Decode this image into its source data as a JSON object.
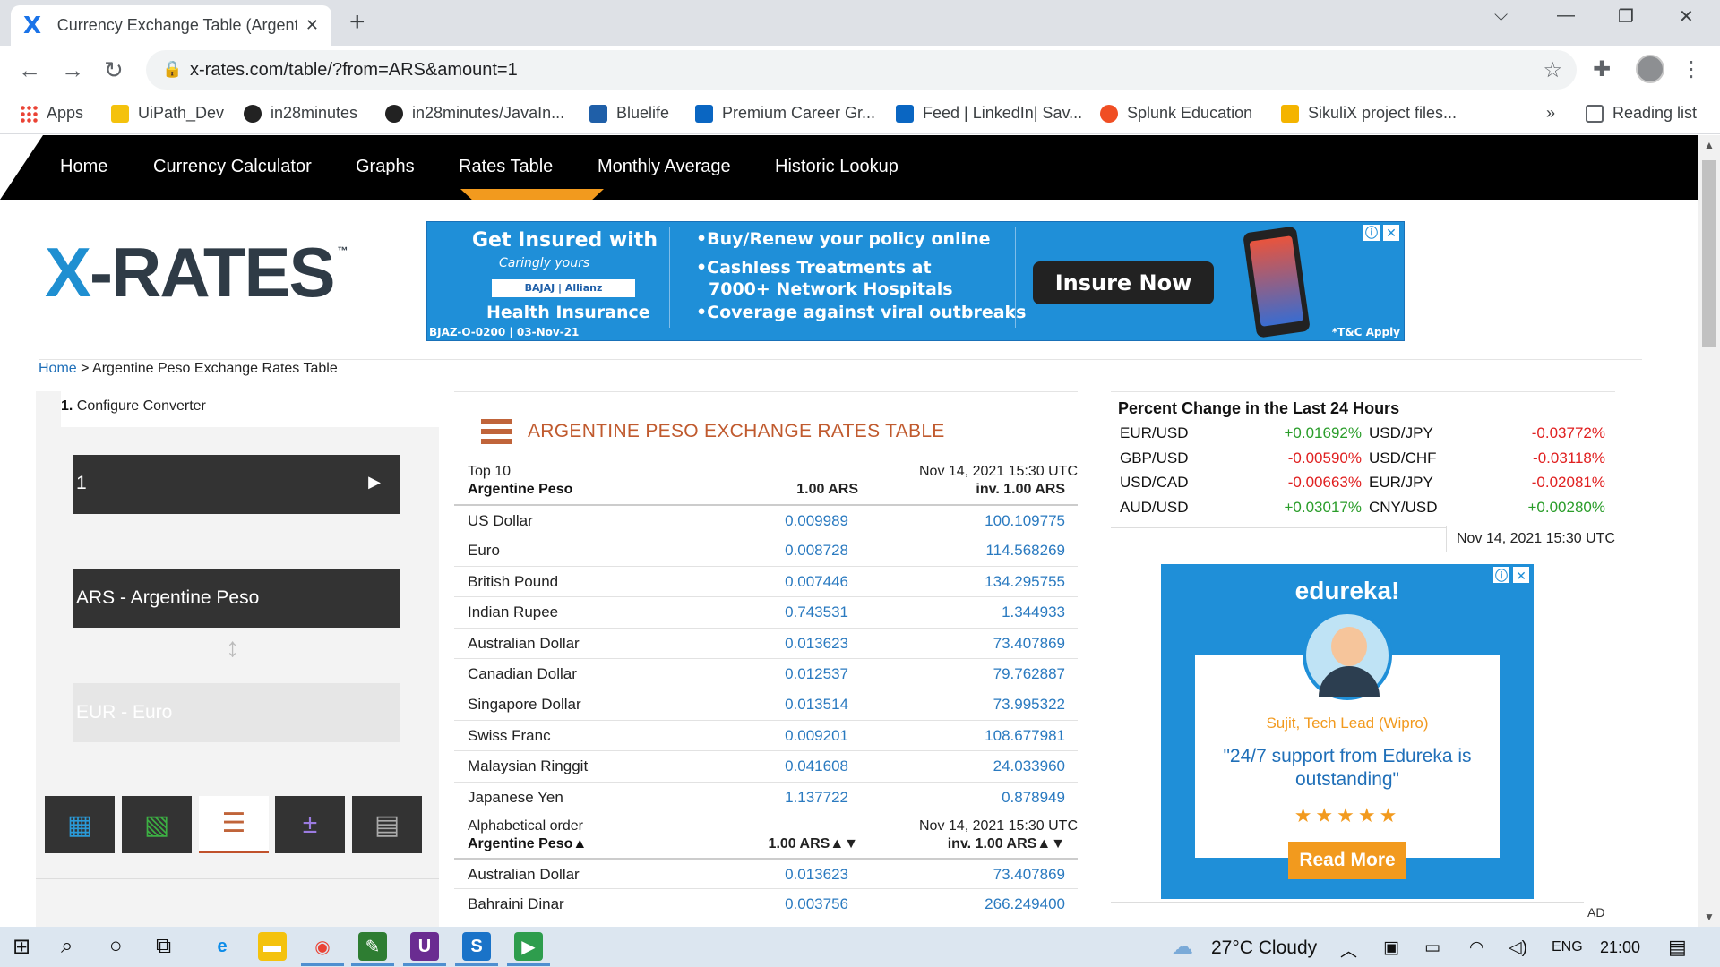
{
  "browser": {
    "tab_title": "Currency Exchange Table (Argentine Peso - ARS) - X-Rates",
    "tab_close": "✕",
    "new_tab": "+",
    "url": "x-rates.com/table/?from=ARS&amount=1",
    "bookmarks": [
      {
        "label": "Apps",
        "color": "#ea4335"
      },
      {
        "label": "UiPath_Dev",
        "color": "#f4c20d"
      },
      {
        "label": "in28minutes",
        "color": "#222222"
      },
      {
        "label": "in28minutes/JavaIn...",
        "color": "#222222"
      },
      {
        "label": "Bluelife",
        "color": "#1f5fa8"
      },
      {
        "label": "Premium Career Gr...",
        "color": "#0a66c2"
      },
      {
        "label": "Feed | LinkedIn| Sav...",
        "color": "#0a66c2"
      },
      {
        "label": "Splunk Education",
        "color": "#f04e23"
      },
      {
        "label": "SikuliX project files...",
        "color": "#f4b400"
      }
    ],
    "overflow": "»",
    "reading_list": "Reading list"
  },
  "site": {
    "nav": [
      "Home",
      "Currency Calculator",
      "Graphs",
      "Rates Table",
      "Monthly Average",
      "Historic Lookup"
    ],
    "active_nav": "Rates Table",
    "accent_color": "#f29a1e",
    "logo_x": "X",
    "logo_rest": "-RATES",
    "logo_tm": "™"
  },
  "ad_top": {
    "headline": "Get Insured with",
    "tagline": "Caringly yours",
    "brand": "BAJAJ | Allianz",
    "product": "Health Insurance",
    "code": "BJAZ-O-0200 | 03-Nov-21",
    "bullets": [
      "•Buy/Renew your policy online",
      "•Cashless Treatments at",
      "7000+ Network Hospitals",
      "•Coverage against viral outbreaks"
    ],
    "cta": "Insure Now",
    "tc": "*T&C Apply"
  },
  "breadcrumb": {
    "home": "Home",
    "sep": " > ",
    "current": "Argentine Peso Exchange Rates Table"
  },
  "converter": {
    "step_num": "1.",
    "step_label": "Configure Converter",
    "amount": "1",
    "from": "ARS - Argentine Peso",
    "to": "EUR - Euro"
  },
  "table": {
    "title": "ARGENTINE PESO EXCHANGE RATES TABLE",
    "top_label": "Top 10",
    "date": "Nov 14, 2021 15:30 UTC",
    "base": "Argentine Peso",
    "col1": "1.00 ARS",
    "col2": "inv. 1.00 ARS",
    "top10": [
      {
        "name": "US Dollar",
        "rate": "0.009989",
        "inv": "100.109775"
      },
      {
        "name": "Euro",
        "rate": "0.008728",
        "inv": "114.568269"
      },
      {
        "name": "British Pound",
        "rate": "0.007446",
        "inv": "134.295755"
      },
      {
        "name": "Indian Rupee",
        "rate": "0.743531",
        "inv": "1.344933"
      },
      {
        "name": "Australian Dollar",
        "rate": "0.013623",
        "inv": "73.407869"
      },
      {
        "name": "Canadian Dollar",
        "rate": "0.012537",
        "inv": "79.762887"
      },
      {
        "name": "Singapore Dollar",
        "rate": "0.013514",
        "inv": "73.995322"
      },
      {
        "name": "Swiss Franc",
        "rate": "0.009201",
        "inv": "108.677981"
      },
      {
        "name": "Malaysian Ringgit",
        "rate": "0.041608",
        "inv": "24.033960"
      },
      {
        "name": "Japanese Yen",
        "rate": "1.137722",
        "inv": "0.878949"
      }
    ],
    "alpha_label": "Alphabetical order",
    "alpha_base": "Argentine Peso▲",
    "alpha_col1": "1.00 ARS▲▼",
    "alpha_col2": "inv. 1.00 ARS▲▼",
    "alpha": [
      {
        "name": "Australian Dollar",
        "rate": "0.013623",
        "inv": "73.407869"
      },
      {
        "name": "Bahraini Dinar",
        "rate": "0.003756",
        "inv": "266.249400"
      }
    ]
  },
  "percent_change": {
    "title": "Percent Change in the Last 24 Hours",
    "rows": [
      {
        "p1": "EUR/USD",
        "v1": "+0.01692%",
        "p2": "USD/JPY",
        "v2": "-0.03772%"
      },
      {
        "p1": "GBP/USD",
        "v1": "-0.00590%",
        "p2": "USD/CHF",
        "v2": "-0.03118%"
      },
      {
        "p1": "USD/CAD",
        "v1": "-0.00663%",
        "p2": "EUR/JPY",
        "v2": "-0.02081%"
      },
      {
        "p1": "AUD/USD",
        "v1": "+0.03017%",
        "p2": "CNY/USD",
        "v2": "+0.00280%"
      }
    ],
    "date": "Nov 14, 2021 15:30 UTC",
    "pos_color": "#2a9d2a",
    "neg_color": "#e02020"
  },
  "ad_side": {
    "brand": "edureka!",
    "who": "Sujit, Tech Lead (Wipro)",
    "quote": "\"24/7 support from Edureka is outstanding\"",
    "stars": "★★★★★",
    "cta": "Read More",
    "ad_label": "AD"
  },
  "taskbar": {
    "weather": "27°C  Cloudy",
    "lang": "ENG",
    "time": "21:00"
  }
}
